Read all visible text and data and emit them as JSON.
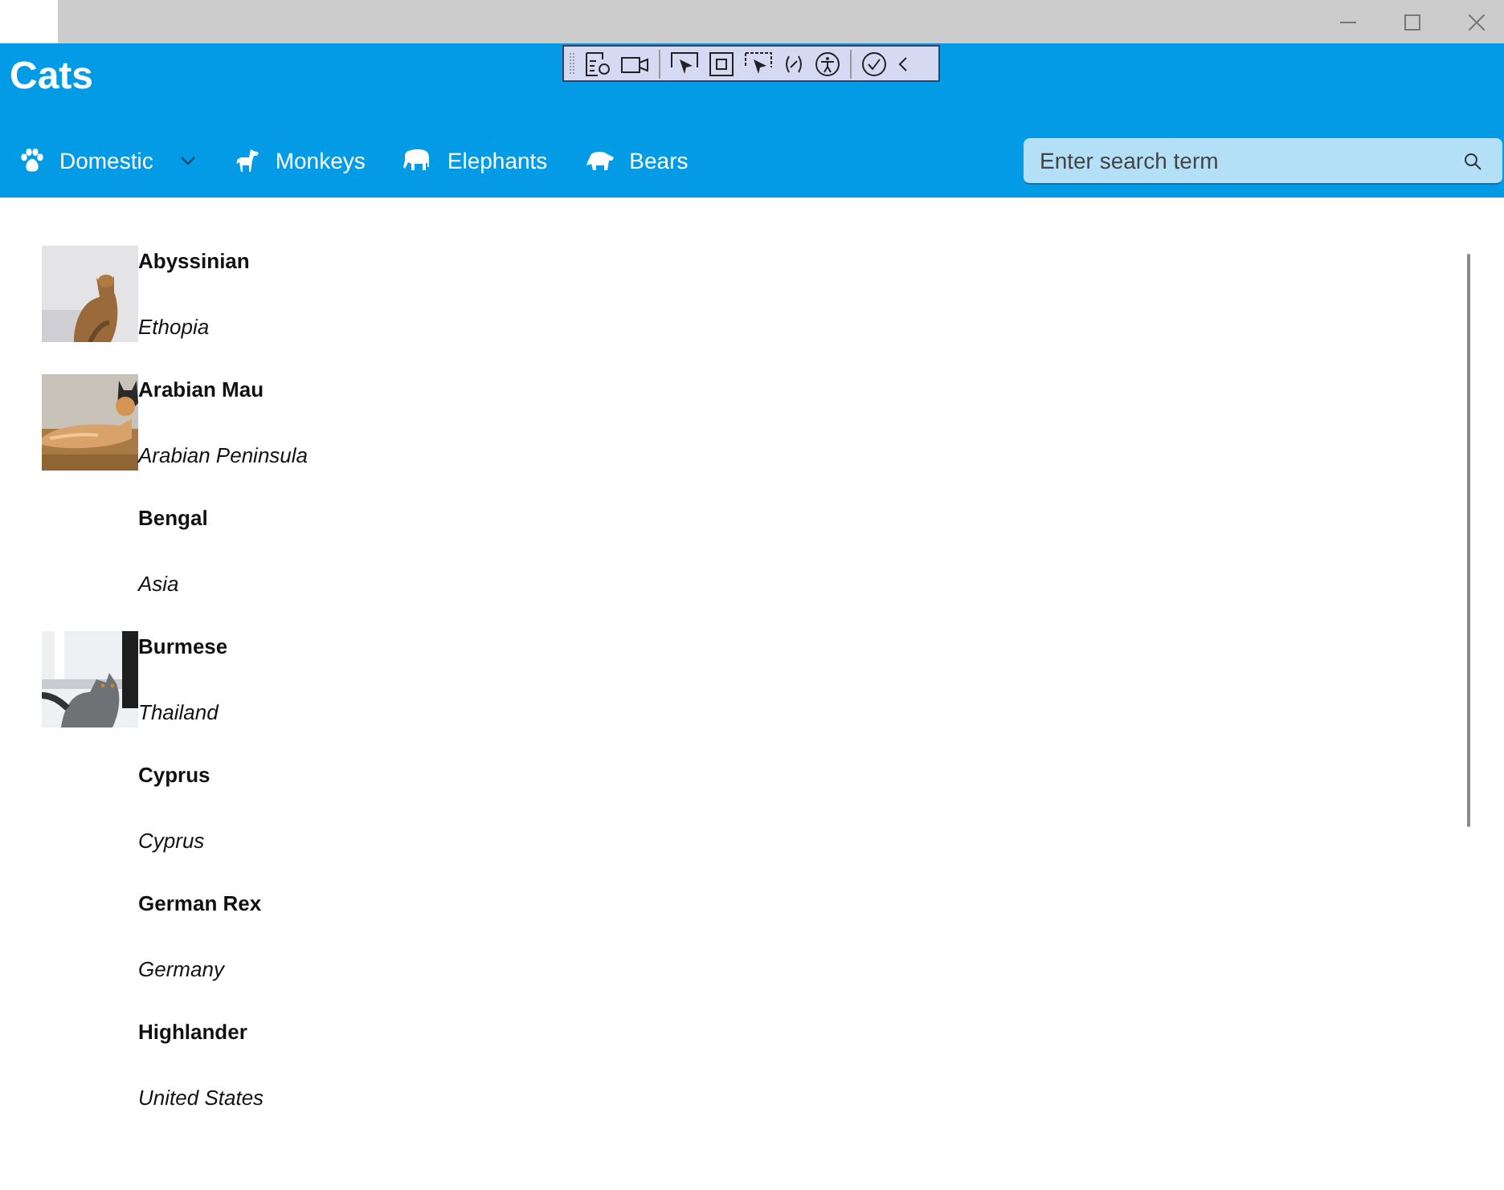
{
  "app": {
    "title": "Cats"
  },
  "nav": [
    {
      "label": "Domestic",
      "dropdown": true
    },
    {
      "label": "Monkeys",
      "dropdown": false
    },
    {
      "label": "Elephants",
      "dropdown": false
    },
    {
      "label": "Bears",
      "dropdown": false
    }
  ],
  "search": {
    "placeholder": "Enter search term"
  },
  "cats": [
    {
      "name": "Abyssinian",
      "origin": "Ethopia",
      "kind": "picture"
    },
    {
      "name": "Arabian Mau",
      "origin": "Arabian Peninsula",
      "kind": "picture"
    },
    {
      "name": "Bengal",
      "origin": "Asia",
      "kind": "text"
    },
    {
      "name": "Burmese",
      "origin": "Thailand",
      "kind": "picture"
    },
    {
      "name": "Cyprus",
      "origin": "Cyprus",
      "kind": "text"
    },
    {
      "name": "German Rex",
      "origin": "Germany",
      "kind": "text"
    },
    {
      "name": "Highlander",
      "origin": "United States",
      "kind": "text"
    }
  ]
}
